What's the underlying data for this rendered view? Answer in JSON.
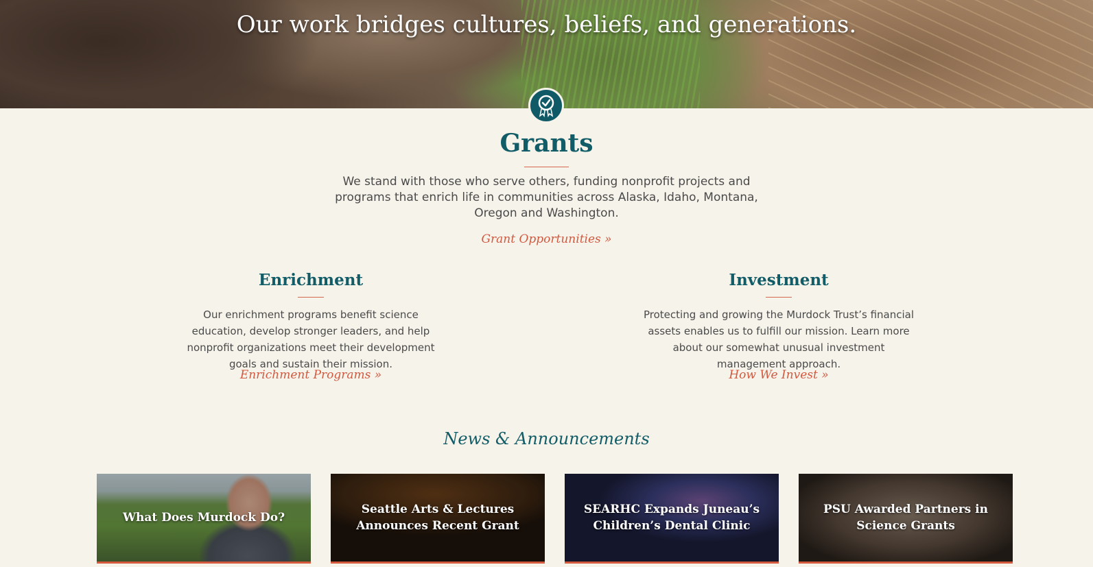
{
  "hero": {
    "title": "Our work bridges cultures, beliefs, and generations."
  },
  "grants": {
    "badge_icon": "award-ribbon-icon",
    "title": "Grants",
    "description": "We stand with those who serve others, funding nonprofit projects and programs that enrich life in communities across Alaska, Idaho, Montana, Oregon and Washington.",
    "link": "Grant Opportunities »"
  },
  "enrichment": {
    "title": "Enrichment",
    "description": "Our enrichment programs benefit science education, develop stronger leaders, and help nonprofit organizations meet their development goals and sustain their mission.",
    "link": "Enrichment Programs »"
  },
  "investment": {
    "title": "Investment",
    "description": "Protecting and growing the Murdock Trust’s financial assets enables us to fulfill our mission. Learn more about our somewhat unusual investment management approach.",
    "link": "How We Invest »"
  },
  "news": {
    "title": "News & Announcements",
    "cards": [
      {
        "label": "What Does Murdock Do?"
      },
      {
        "label": "Seattle Arts & Lectures Announces Recent Grant"
      },
      {
        "label": "SEARHC Expands Juneau’s Children’s Dental Clinic"
      },
      {
        "label": "PSU Awarded Partners in Science Grants"
      }
    ]
  },
  "colors": {
    "background": "#f6f3ea",
    "heading_teal": "#125c67",
    "link_orange": "#d1593f",
    "accent_rule": "#d5674d"
  }
}
